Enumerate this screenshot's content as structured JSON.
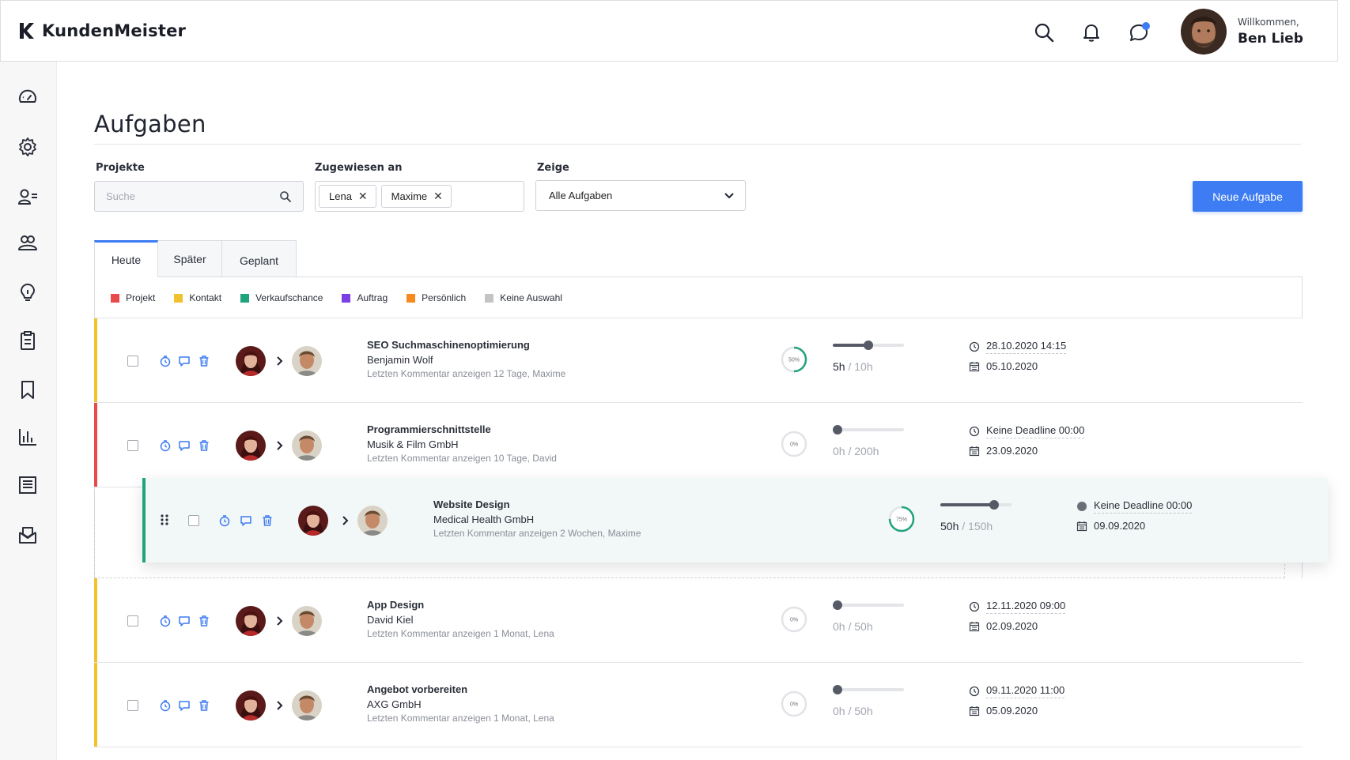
{
  "app": {
    "brand": "KundenMeister"
  },
  "header": {
    "welcome": "Willkommen,",
    "user_name": "Ben Lieb"
  },
  "page": {
    "title": "Aufgaben"
  },
  "filters": {
    "projects_label": "Projekte",
    "search_placeholder": "Suche",
    "assigned_label": "Zugewiesen an",
    "assigned_chips": [
      "Lena",
      "Maxime"
    ],
    "show_label": "Zeige",
    "show_value": "Alle Aufgaben",
    "new_button": "Neue Aufgabe"
  },
  "tabs": [
    "Heute",
    "Später",
    "Geplant"
  ],
  "legend": [
    {
      "label": "Projekt",
      "color": "#e84b4b"
    },
    {
      "label": "Kontakt",
      "color": "#f2c12e"
    },
    {
      "label": "Verkaufschance",
      "color": "#21a37d"
    },
    {
      "label": "Auftrag",
      "color": "#7b3fe4"
    },
    {
      "label": "Persönlich",
      "color": "#f58a1f"
    },
    {
      "label": "Keine Auswahl",
      "color": "#c4c4c4"
    }
  ],
  "tasks": [
    {
      "title": "SEO Suchmaschinenoptimierung",
      "client": "Benjamin Wolf",
      "meta": "Letzten Kommentar anzeigen 12 Tage, Maxime",
      "percent_label": "50%",
      "progress": 0.5,
      "used": "5h",
      "total": " / 10h",
      "deadline": "28.10.2020 14:15",
      "date": "05.10.2020",
      "stripe": "#f2c12e"
    },
    {
      "title": "Programmierschnittstelle",
      "client": "Musik & Film GmbH",
      "meta": "Letzten Kommentar anzeigen 10 Tage, David",
      "percent_label": "0%",
      "progress": 0,
      "used": "0h",
      "total": " / 200h",
      "deadline": "Keine Deadline 00:00",
      "date": "23.09.2020",
      "stripe": "#e84b4b"
    },
    {
      "title": "Website Design",
      "client": "Medical Health GmbH",
      "meta": "Letzten Kommentar anzeigen 2 Wochen, Maxime",
      "percent_label": "75%",
      "progress": 0.75,
      "used": "50h",
      "total": " / 150h",
      "deadline": "Keine Deadline 00:00",
      "date": "09.09.2020",
      "stripe": "#21a37d"
    },
    {
      "title": "App Design",
      "client": "David Kiel",
      "meta": "Letzten Kommentar anzeigen 1 Monat, Lena",
      "percent_label": "0%",
      "progress": 0,
      "used": "0h",
      "total": " / 50h",
      "deadline": "12.11.2020 09:00",
      "date": "02.09.2020",
      "stripe": "#f2c12e"
    },
    {
      "title": "Angebot vorbereiten",
      "client": "AXG GmbH",
      "meta": "Letzten Kommentar anzeigen 1 Monat, Lena",
      "percent_label": "0%",
      "progress": 0,
      "used": "0h",
      "total": " / 50h",
      "deadline": "09.11.2020 11:00",
      "date": "05.09.2020",
      "stripe": "#f2c12e"
    }
  ]
}
